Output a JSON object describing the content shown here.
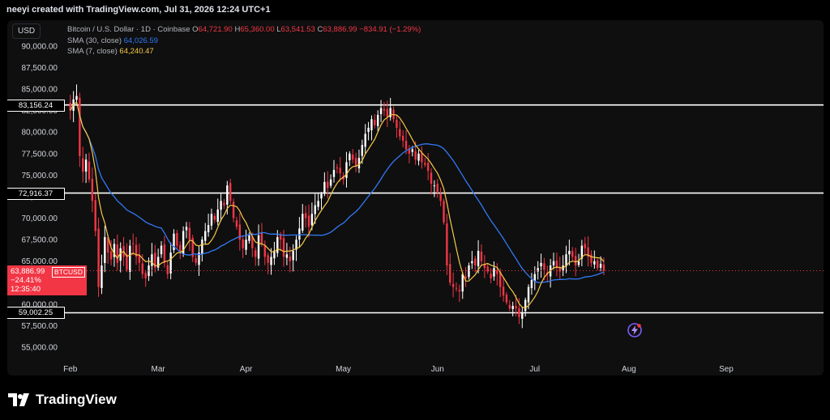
{
  "header": {
    "credit": "neeyi created with TradingView.com, Jul 31, 2026 12:24 UTC+1"
  },
  "toolbar": {
    "currency": "USD"
  },
  "legend": {
    "instrument": "Bitcoin / U.S. Dollar · 1D · Coinbase",
    "open_label": "O",
    "open": "64,721.90",
    "high_label": "H",
    "high": "65,360.00",
    "low_label": "L",
    "low": "63,541.53",
    "close_label": "C",
    "close": "63,886.99",
    "change": "−834.91 (−1.29%)",
    "sma30_label": "SMA (30, close)",
    "sma30_value": "64,026.59",
    "sma7_label": "SMA (7, close)",
    "sma7_value": "64,240.47"
  },
  "levels": [
    {
      "label": "83,156.24",
      "value": 83156.24
    },
    {
      "label": "72,916.37",
      "value": 72916.37
    },
    {
      "label": "59,002.25",
      "value": 59002.25
    }
  ],
  "current_price": {
    "symbol": "BTCUSD",
    "price": "63,886.99",
    "change_pct": "−24.41%",
    "countdown": "12:35:40",
    "value": 63886.99
  },
  "colors": {
    "up": "#ffffff",
    "down": "#f23645",
    "sma30": "#3179f5",
    "sma7": "#f7c948",
    "level": "#ffffff",
    "grid": "#1c1c1c",
    "axis_text": "#d1d4dc"
  },
  "brand": {
    "name": "TradingView",
    "logo_icon": "tradingview-logo-icon",
    "bolt_icon": "lightning-icon"
  },
  "chart_data": {
    "type": "candlestick",
    "title": "Bitcoin / U.S. Dollar · 1D · Coinbase",
    "xlabel": "",
    "ylabel": "",
    "ylim": [
      53500,
      93000
    ],
    "x_ticks": [
      "Feb",
      "Mar",
      "Apr",
      "May",
      "Jun",
      "Jul",
      "Aug",
      "Sep"
    ],
    "y_ticks": [
      "55,000.00",
      "57,500.00",
      "60,000.00",
      "62,500.00",
      "65,000.00",
      "67,500.00",
      "70,000.00",
      "72,500.00",
      "75,000.00",
      "77,500.00",
      "80,000.00",
      "82,500.00",
      "85,000.00",
      "87,500.00",
      "90,000.00"
    ],
    "y_tick_values": [
      55000,
      57500,
      60000,
      62500,
      65000,
      67500,
      70000,
      72500,
      75000,
      77500,
      80000,
      82500,
      85000,
      87500,
      90000
    ],
    "x_tick_days": [
      0,
      28,
      56,
      87,
      117,
      148,
      178,
      209
    ],
    "x_range_days": [
      -2,
      240
    ],
    "grid": false,
    "date_start": "Feb 1",
    "closes": [
      82500,
      83800,
      84200,
      77200,
      75400,
      76800,
      74500,
      72000,
      68500,
      62000,
      64500,
      67800,
      66000,
      65200,
      67000,
      64800,
      66500,
      65500,
      64000,
      66800,
      67000,
      65500,
      64800,
      63500,
      63000,
      64500,
      65800,
      64200,
      65500,
      66800,
      64800,
      63500,
      66000,
      68200,
      66800,
      66000,
      68500,
      69000,
      67500,
      65500,
      64800,
      66000,
      67500,
      68500,
      69200,
      70500,
      69800,
      71000,
      72000,
      71500,
      73800,
      72000,
      70000,
      69000,
      67500,
      66500,
      67500,
      68000,
      66500,
      65500,
      68000,
      67000,
      65500,
      64800,
      65500,
      66200,
      67800,
      67500,
      65500,
      65800,
      65000,
      66200,
      67500,
      68800,
      70500,
      70000,
      69000,
      70500,
      71500,
      72000,
      72800,
      74200,
      73500,
      74500,
      75600,
      75800,
      75200,
      74500,
      76500,
      77500,
      76800,
      76000,
      77000,
      78500,
      79800,
      80500,
      81500,
      80800,
      82000,
      82800,
      82500,
      81800,
      82800,
      81500,
      80500,
      79500,
      79000,
      78000,
      77500,
      78000,
      76800,
      77500,
      76500,
      76200,
      75500,
      74000,
      73800,
      73000,
      72000,
      69500,
      64500,
      62500,
      62000,
      61800,
      61500,
      63500,
      63000,
      64500,
      65000,
      64500,
      66200,
      65000,
      64200,
      63800,
      63000,
      64200,
      63500,
      62000,
      61000,
      60200,
      59500,
      59800,
      59500,
      58500,
      59000,
      60500,
      62000,
      62800,
      63500,
      64200,
      64800,
      64000,
      63500,
      64500,
      65000,
      64200,
      63800,
      64500,
      65800,
      66200,
      65500,
      64500,
      65000,
      66800,
      66500,
      65500,
      64800,
      65000,
      64200,
      64700,
      63887
    ],
    "sma7_note": "computed from closes",
    "series": [
      {
        "name": "SMA (30, close)",
        "last": 64026.59
      },
      {
        "name": "SMA (7, close)",
        "last": 64240.47
      }
    ]
  }
}
